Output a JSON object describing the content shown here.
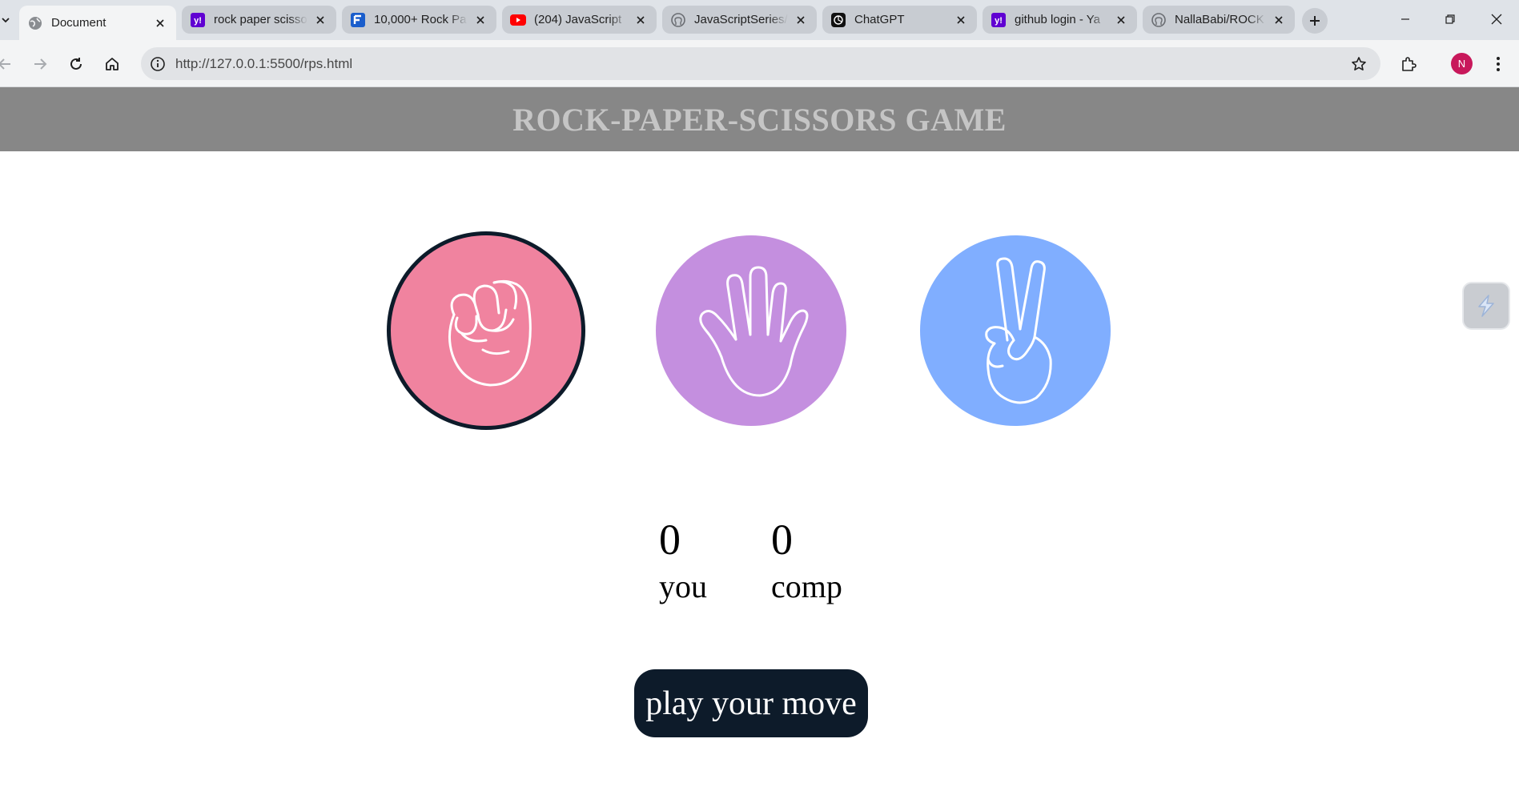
{
  "browser": {
    "tabs": [
      {
        "title": "Document",
        "icon": "globe-icon",
        "active": true
      },
      {
        "title": "rock paper scisso",
        "icon": "yahoo-icon",
        "active": false
      },
      {
        "title": "10,000+ Rock Pa",
        "icon": "flaticon-icon",
        "active": false
      },
      {
        "title": "(204) JavaScript",
        "icon": "youtube-icon",
        "active": false
      },
      {
        "title": "JavaScriptSeries/",
        "icon": "github-icon",
        "active": false
      },
      {
        "title": "ChatGPT",
        "icon": "chatgpt-icon",
        "active": false
      },
      {
        "title": "github login - Ya",
        "icon": "yahoo-icon",
        "active": false
      },
      {
        "title": "NallaBabi/ROCK",
        "icon": "github-icon",
        "active": false
      }
    ],
    "address": {
      "url": "http://127.0.0.1:5500/rps.html"
    },
    "profile_initial": "N"
  },
  "page": {
    "title": "ROCK-PAPER-SCISSORS GAME",
    "choices": [
      {
        "id": "rock",
        "icon": "fist-icon",
        "color": "#f0839f",
        "selected": true
      },
      {
        "id": "paper",
        "icon": "open-hand-icon",
        "color": "#c48fdf",
        "selected": false
      },
      {
        "id": "scissors",
        "icon": "peace-hand-icon",
        "color": "#80aeff",
        "selected": false
      }
    ],
    "scores": {
      "user_score": "0",
      "user_label": "you",
      "comp_score": "0",
      "comp_label": "comp"
    },
    "play_button": "play your move"
  },
  "colors": {
    "header_bg": "#878787",
    "header_text": "#c5c5c5",
    "button_bg": "#0d1b2a",
    "selected_ring": "#0d1b2a"
  }
}
